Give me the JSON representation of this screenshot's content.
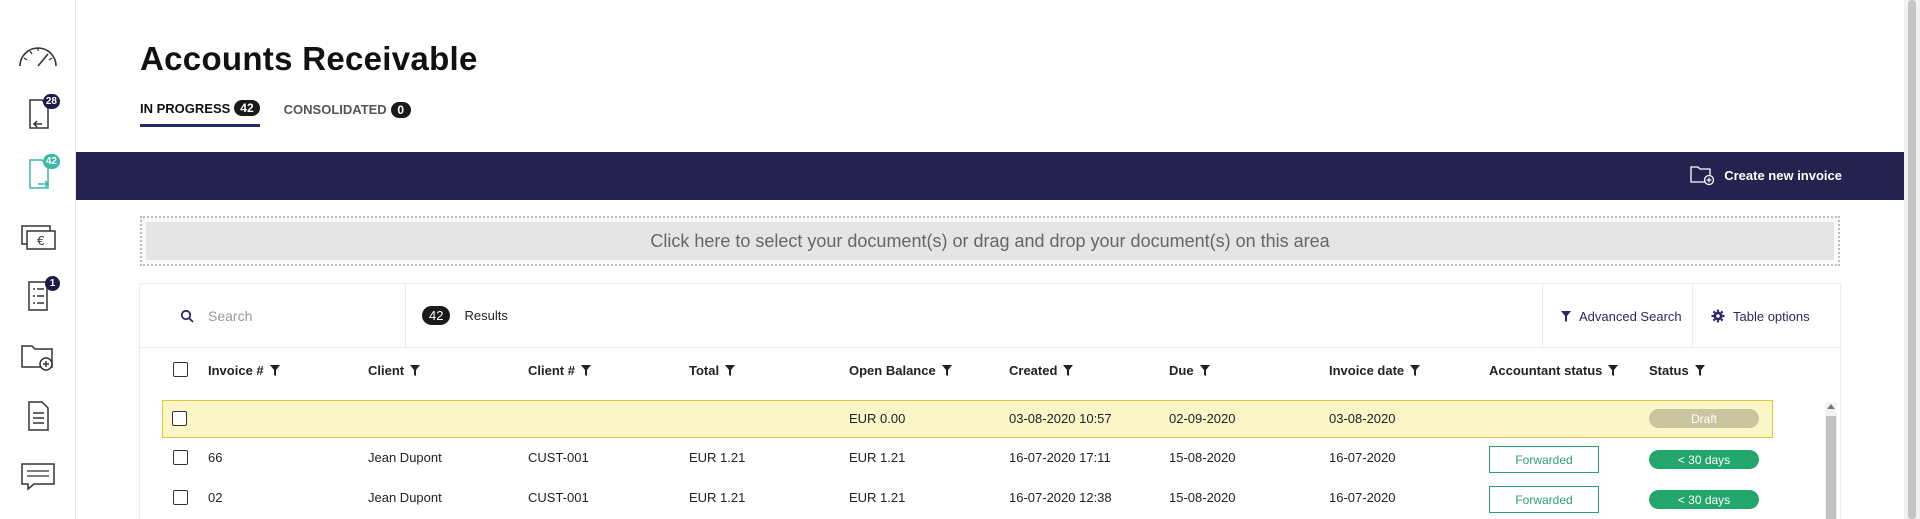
{
  "sidebar": {
    "items": [
      {
        "name": "dashboard",
        "icon": "speedometer-icon",
        "badge": ""
      },
      {
        "name": "incoming-documents",
        "icon": "document-incoming-icon",
        "badge": "28"
      },
      {
        "name": "outgoing-documents",
        "icon": "document-outgoing-icon",
        "badge": "42"
      },
      {
        "name": "payments",
        "icon": "euro-cash-icon",
        "badge": ""
      },
      {
        "name": "checklist",
        "icon": "checklist-icon",
        "badge": "1"
      },
      {
        "name": "folder-add",
        "icon": "folder-add-icon",
        "badge": ""
      },
      {
        "name": "documents",
        "icon": "document-lines-icon",
        "badge": ""
      },
      {
        "name": "messages",
        "icon": "chat-icon",
        "badge": ""
      }
    ]
  },
  "page": {
    "title": "Accounts Receivable"
  },
  "tabs": [
    {
      "label": "IN PROGRESS",
      "count": "42"
    },
    {
      "label": "CONSOLIDATED",
      "count": "0"
    }
  ],
  "toolbar": {
    "create_label": "Create new invoice"
  },
  "dropzone": {
    "text": "Click here to select your document(s) or drag and drop your document(s) on this area"
  },
  "search": {
    "placeholder": "Search",
    "results_count": "42",
    "results_label": "Results"
  },
  "actions": {
    "advanced_search": "Advanced Search",
    "table_options": "Table options"
  },
  "table": {
    "columns": [
      "Invoice #",
      "Client",
      "Client #",
      "Total",
      "Open Balance",
      "Created",
      "Due",
      "Invoice date",
      "Accountant status",
      "Status"
    ],
    "rows": [
      {
        "invoice": "",
        "client": "",
        "client_no": "",
        "total": "",
        "open_balance": "EUR 0.00",
        "created": "03-08-2020 10:57",
        "due": "02-09-2020",
        "invoice_date": "03-08-2020",
        "accountant_status": "",
        "status": "Draft"
      },
      {
        "invoice": "66",
        "client": "Jean Dupont",
        "client_no": "CUST-001",
        "total": "EUR 1.21",
        "open_balance": "EUR 1.21",
        "created": "16-07-2020 17:11",
        "due": "15-08-2020",
        "invoice_date": "16-07-2020",
        "accountant_status": "Forwarded",
        "status": "< 30 days"
      },
      {
        "invoice": "02",
        "client": "Jean Dupont",
        "client_no": "CUST-001",
        "total": "EUR 1.21",
        "open_balance": "EUR 1.21",
        "created": "16-07-2020 12:38",
        "due": "15-08-2020",
        "invoice_date": "16-07-2020",
        "accountant_status": "Forwarded",
        "status": "< 30 days"
      }
    ]
  },
  "colors": {
    "navy": "#25224f",
    "green": "#21a66b",
    "draft": "#c9c59e",
    "highlight": "#fbf6c7",
    "teal": "#3ab7a7"
  }
}
